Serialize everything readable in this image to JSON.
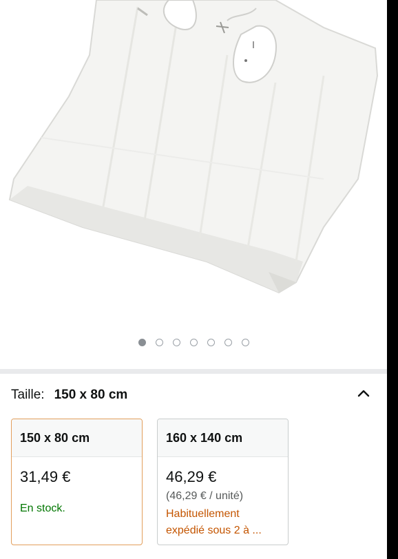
{
  "colors": {
    "selected_border": "#e29e5b",
    "in_stock": "#007600",
    "delayed": "#c45500",
    "carousel_dot_active": "#8a8f94"
  },
  "gallery": {
    "image_icon": "electric-blanket-photo",
    "dots_count": 7,
    "active_dot_index": 0
  },
  "size_selector": {
    "label": "Taille:",
    "value": "150 x 80 cm",
    "toggle_icon": "chevron-up-icon"
  },
  "options": [
    {
      "size": "150 x 80 cm",
      "price": "31,49 €",
      "availability": "En stock.",
      "selected": true
    },
    {
      "size": "160 x 140 cm",
      "price": "46,29 €",
      "unit_price": "(46,29 € / unité)",
      "availability_line1": "Habituellement",
      "availability_line2": "expédié sous 2 à ...",
      "selected": false
    }
  ]
}
